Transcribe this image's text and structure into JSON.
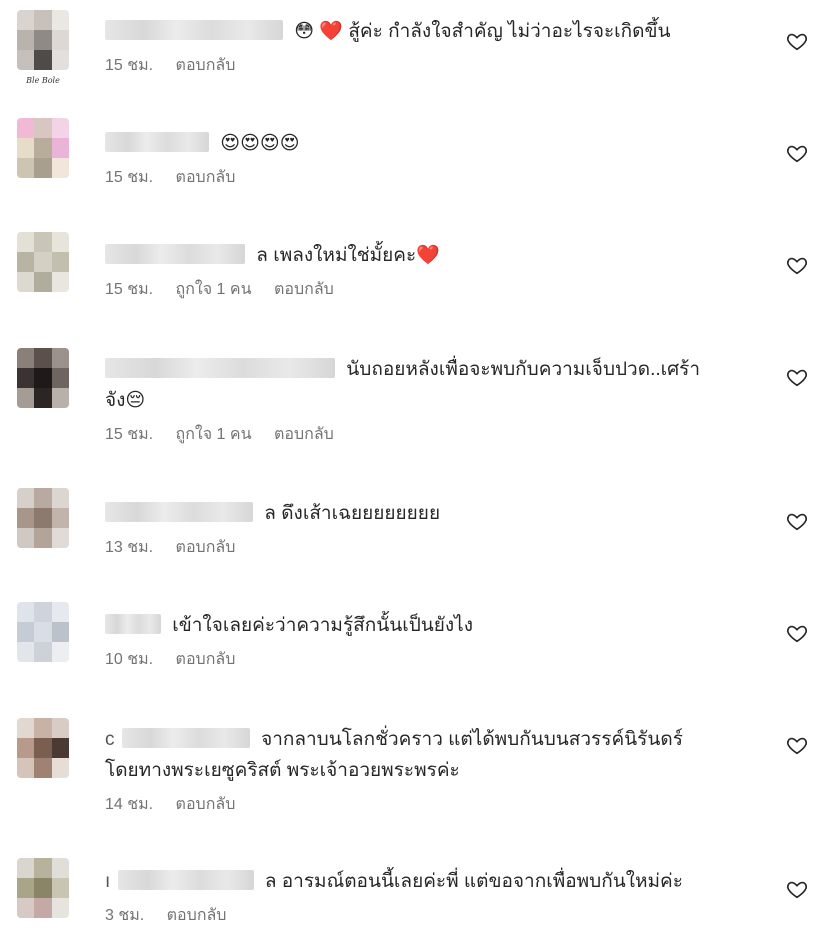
{
  "comments": [
    {
      "avatar_colors": [
        "#d9d4cf",
        "#c8c1bb",
        "#ebe7e3",
        "#b9b3ad",
        "#8f8a86",
        "#ddd8d4",
        "#c5c0bb",
        "#4f4b48",
        "#e2dfdc"
      ],
      "avatar_caption": "Ble Bole",
      "prefix": "",
      "emoji_before": "😳 ❤️",
      "text": "สู้ค่ะ กำลังใจสำคัญ ไม่ว่าอะไรจะเกิดขึ้น",
      "time": "15 ชม.",
      "likes": "",
      "reply": "ตอบกลับ"
    },
    {
      "avatar_colors": [
        "#f1b9d6",
        "#d8c6c0",
        "#f3d4e6",
        "#e7dcc8",
        "#b8ad9a",
        "#e9b4d7",
        "#cdc5b2",
        "#a99f8e",
        "#f2e6da"
      ],
      "avatar_caption": "",
      "prefix": "",
      "emoji_before": "",
      "text": "😍😍😍😍",
      "time": "15 ชม.",
      "likes": "",
      "reply": "ตอบกลับ"
    },
    {
      "avatar_colors": [
        "#e3e0d6",
        "#c9c6b8",
        "#e6e4db",
        "#b7b4a3",
        "#d4d1c4",
        "#c2bfae",
        "#dcdad0",
        "#b0ad9c",
        "#e8e6de"
      ],
      "avatar_caption": "",
      "prefix": "",
      "emoji_before": "",
      "text": "ล เพลงใหม่ใช่มั้ยคะ❤️",
      "time": "15 ชม.",
      "likes": "ถูกใจ 1 คน",
      "reply": "ตอบกลับ"
    },
    {
      "avatar_colors": [
        "#8a7f79",
        "#5b504b",
        "#9c928c",
        "#3a3331",
        "#1f1a19",
        "#6e6460",
        "#a69c96",
        "#2b2523",
        "#b8b0ab"
      ],
      "avatar_caption": "",
      "prefix": "",
      "emoji_before": "",
      "text": "นับถอยหลังเพื่อจะพบกับความเจ็บปวด..เศร้า",
      "text2": "จัง😔",
      "time": "15 ชม.",
      "likes": "ถูกใจ 1 คน",
      "reply": "ตอบกลับ"
    },
    {
      "avatar_colors": [
        "#d6d0cb",
        "#b8aaa0",
        "#dcd6d1",
        "#a8968a",
        "#8c7a6e",
        "#c2b4aa",
        "#d0c8c2",
        "#b3a49a",
        "#e0dbd7"
      ],
      "avatar_caption": "",
      "prefix": "",
      "emoji_before": "",
      "text": "ล ดึงเส้าเฉยยยยยยยย",
      "time": "13 ชม.",
      "likes": "",
      "reply": "ตอบกลับ"
    },
    {
      "avatar_colors": [
        "#dfe3ea",
        "#cfd4dc",
        "#e6e9ee",
        "#c6ccd5",
        "#d9dde4",
        "#bcc2cb",
        "#e2e5ea",
        "#cdd2d9",
        "#eceef1"
      ],
      "avatar_caption": "",
      "prefix": "",
      "emoji_before": "",
      "text": "เข้าใจเลยค่ะว่าความรู้สึกนั้นเป็นยังไง",
      "time": "10 ชม.",
      "likes": "",
      "reply": "ตอบกลับ"
    },
    {
      "avatar_colors": [
        "#e2d8d2",
        "#c8b2a6",
        "#d9ccc4",
        "#b79a8a",
        "#7a5e50",
        "#4a3a33",
        "#d4c4ba",
        "#a08274",
        "#e6ddd7"
      ],
      "avatar_caption": "",
      "prefix": "c",
      "emoji_before": "",
      "text": "จากลาบนโลกชั่วคราว แต่ได้พบกันบนสวรรค์นิรันดร์",
      "text2": "โดยทางพระเยซูคริสต์ พระเจ้าอวยพระพรค่ะ",
      "time": "14 ชม.",
      "likes": "",
      "reply": "ตอบกลับ"
    },
    {
      "avatar_colors": [
        "#d8d6cf",
        "#b6b29c",
        "#e0ded8",
        "#a9a588",
        "#8a8566",
        "#c9c5b3",
        "#d7c9c4",
        "#c4a9a6",
        "#e6e4de"
      ],
      "avatar_caption": "",
      "prefix": "ı",
      "emoji_before": "",
      "text": "ล อารมณ์ตอนนี้เลยค่ะพี่ แต่ขอจากเพื่อพบกันใหม่ค่ะ",
      "time": "3 ชม.",
      "likes": "",
      "reply": "ตอบกลับ"
    }
  ]
}
